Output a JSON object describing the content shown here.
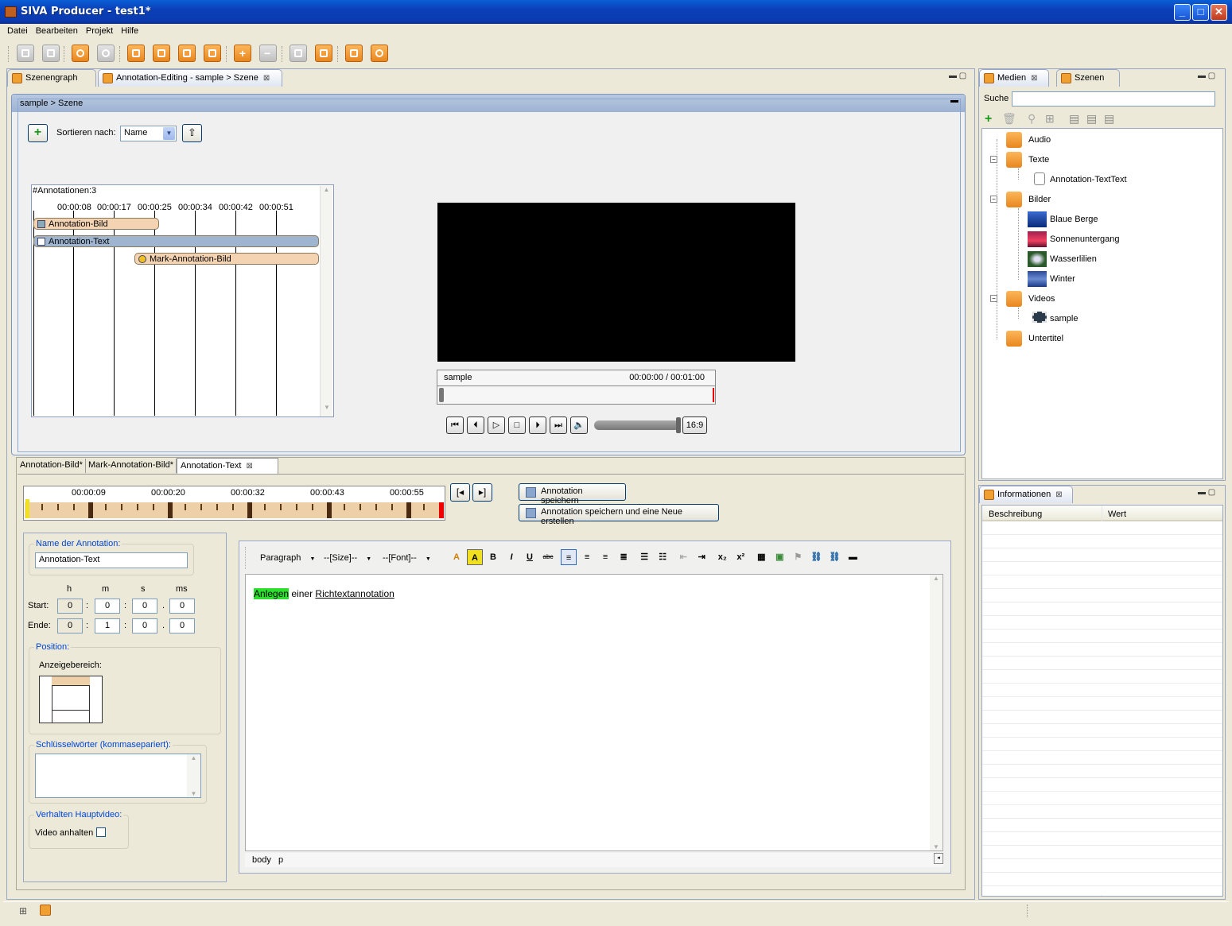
{
  "window": {
    "title": "SIVA Producer - test1*",
    "min": "_",
    "max": "□",
    "close": "✕"
  },
  "menu": [
    "Datei",
    "Bearbeiten",
    "Projekt",
    "Hilfe"
  ],
  "toolbar": {
    "icons": [
      "new-project-icon",
      "open-project-icon",
      "undo-icon",
      "redo-icon",
      "save-icon",
      "save-as-icon",
      "export-icon",
      "publish-icon",
      "add-icon",
      "remove-icon",
      "tree-icon",
      "list-icon",
      "screen-icon",
      "settings-icon"
    ]
  },
  "left_tabs": {
    "scenegraph": "Szenengraph",
    "editor": "Annotation-Editing - sample > Szene"
  },
  "scene": {
    "breadcrumb": "sample > Szene",
    "sort_label": "Sortieren nach:",
    "sort_value": "Name",
    "count": "#Annotationen:3",
    "ticks": [
      "00:00:08",
      "00:00:17",
      "00:00:25",
      "00:00:34",
      "00:00:42",
      "00:00:51"
    ],
    "rows": [
      {
        "label": "Annotation-Bild",
        "color": "#f4d3b3"
      },
      {
        "label": "Annotation-Text",
        "color": "#9fb4cf"
      },
      {
        "label": "Mark-Annotation-Bild",
        "color": "#f4d3b3"
      }
    ],
    "video_name": "sample",
    "video_time": "00:00:00 / 00:01:00",
    "aspect": "16:9"
  },
  "editor_tabs": [
    "Annotation-Bild*",
    "Mark-Annotation-Bild*",
    "Annotation-Text"
  ],
  "annot": {
    "ticks": [
      "00:00:09",
      "00:00:20",
      "00:00:32",
      "00:00:43",
      "00:00:55"
    ],
    "save": "Annotation speichern",
    "save_new": "Annotation speichern und eine Neue erstellen",
    "name_group": "Name der Annotation:",
    "name_value": "Annotation-Text",
    "time_headers": [
      "h",
      "m",
      "s",
      "ms"
    ],
    "start_label": "Start:",
    "end_label": "Ende:",
    "start": [
      "0",
      "0",
      "0",
      "0"
    ],
    "end": [
      "0",
      "1",
      "0",
      "0"
    ],
    "position_group": "Position:",
    "area_label": "Anzeigebereich:",
    "keywords_group": "Schlüsselwörter (kommasepariert):",
    "keywords_value": "",
    "behavior_group": "Verhalten Hauptvideo:",
    "pause_label": "Video anhalten"
  },
  "rte": {
    "paragraph": "Paragraph",
    "size": "--[Size]--",
    "font": "--[Font]--",
    "text_highlight": "Anlegen",
    "text_mid": " einer ",
    "text_link": "Richtextannotation",
    "status": [
      "body",
      "p"
    ]
  },
  "media": {
    "tab_media": "Medien",
    "tab_scenes": "Szenen",
    "search_label": "Suche",
    "search_value": "",
    "tree": [
      {
        "label": "Audio",
        "level": 0
      },
      {
        "label": "Texte",
        "level": 0
      },
      {
        "label": "Annotation-TextText",
        "level": 1
      },
      {
        "label": "Bilder",
        "level": 0
      },
      {
        "label": "Blaue Berge",
        "level": 1
      },
      {
        "label": "Sonnenuntergang",
        "level": 1
      },
      {
        "label": "Wasserlilien",
        "level": 1
      },
      {
        "label": "Winter",
        "level": 1
      },
      {
        "label": "Videos",
        "level": 0
      },
      {
        "label": "sample",
        "level": 1
      },
      {
        "label": "Untertitel",
        "level": 0
      }
    ]
  },
  "info": {
    "title": "Informationen",
    "col1": "Beschreibung",
    "col2": "Wert"
  }
}
